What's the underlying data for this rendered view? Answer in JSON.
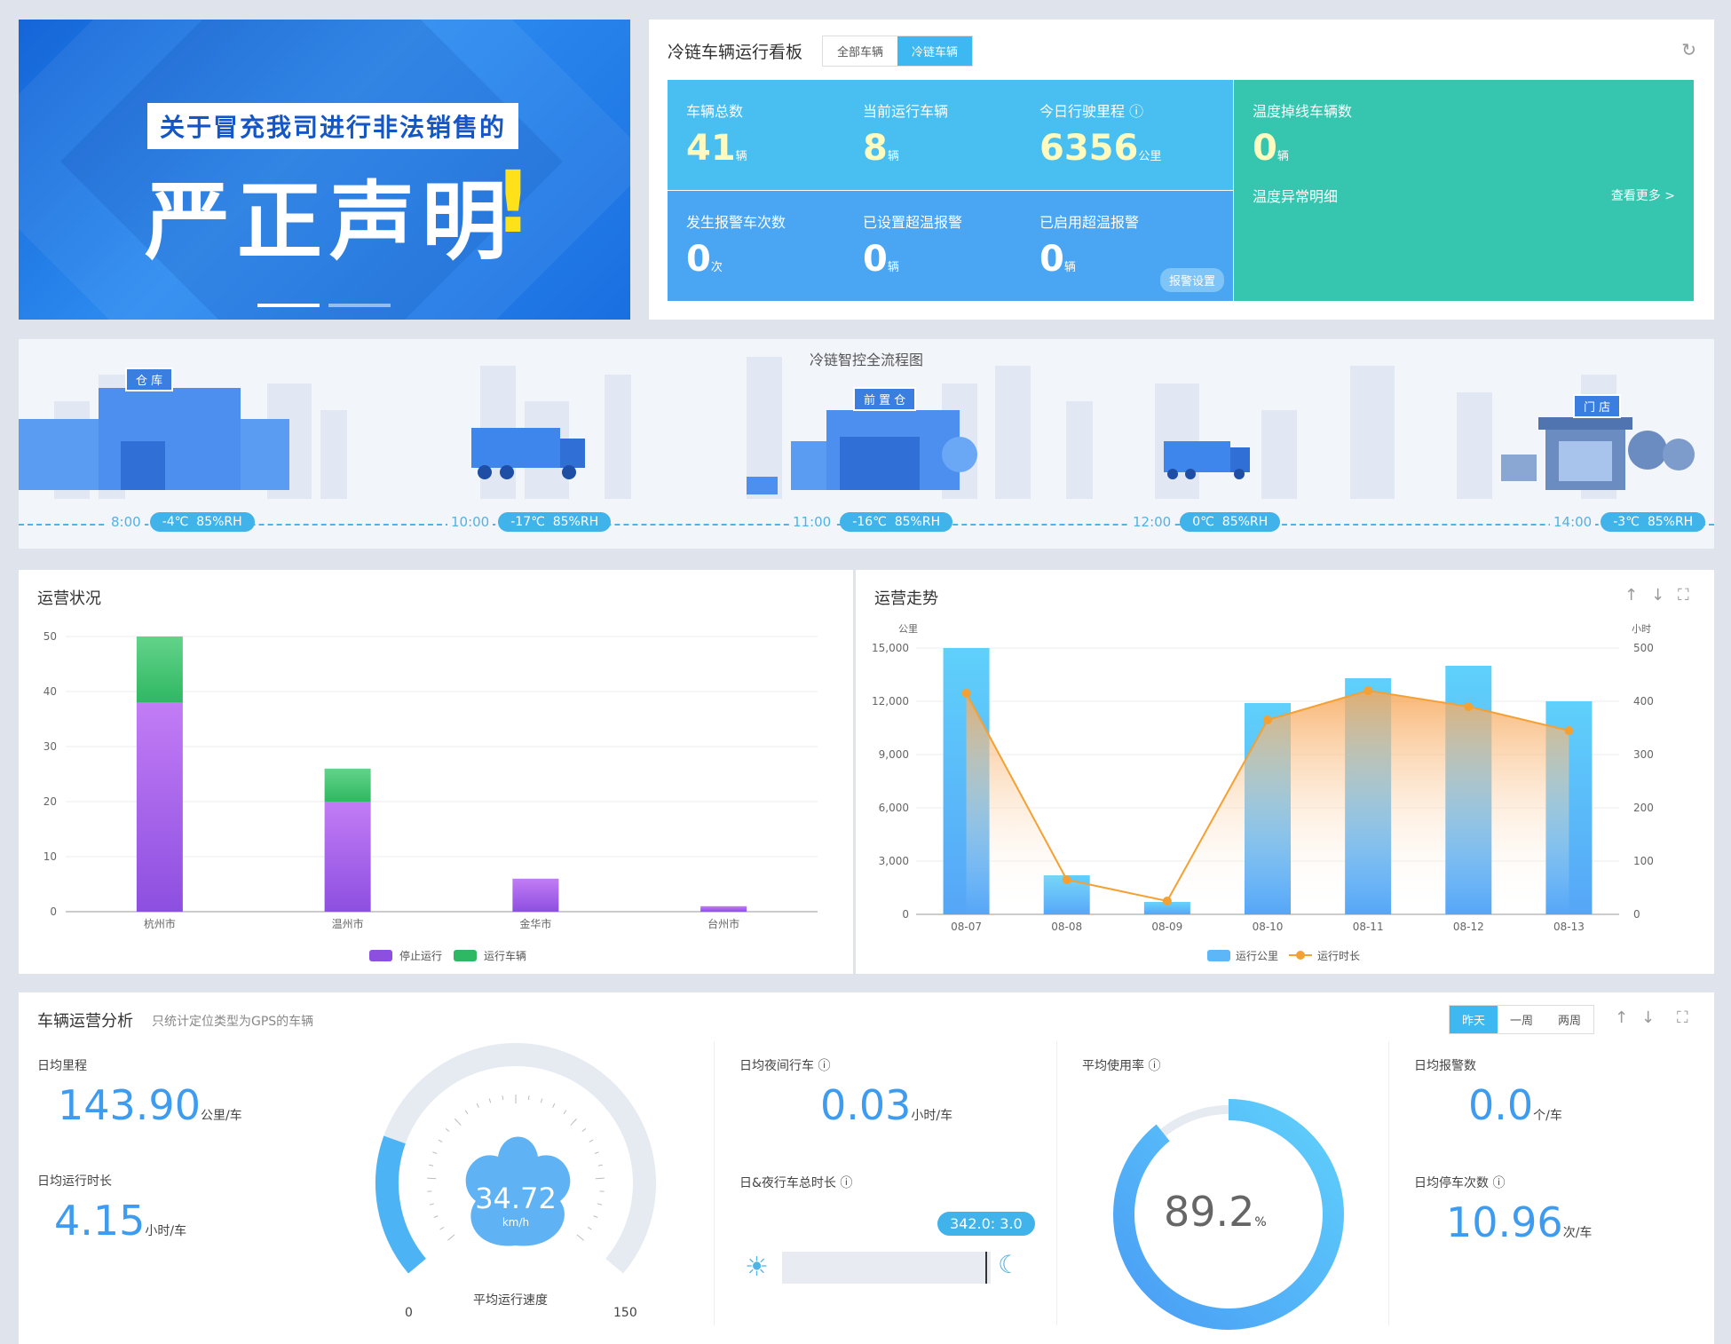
{
  "banner": {
    "subtitle": "关于冒充我司进行非法销售的",
    "headline": "严正声明",
    "exclaim": "!"
  },
  "board": {
    "title": "冷链车辆运行看板",
    "tabs": [
      "全部车辆",
      "冷链车辆"
    ],
    "active_tab": 1,
    "stats_top": [
      {
        "label": "车辆总数",
        "value": "41",
        "unit": "辆"
      },
      {
        "label": "当前运行车辆",
        "value": "8",
        "unit": "辆"
      },
      {
        "label": "今日行驶里程 ⓘ",
        "value": "6356",
        "unit": "公里"
      }
    ],
    "stats_bottom": [
      {
        "label": "发生报警车次数",
        "value": "0",
        "unit": "次"
      },
      {
        "label": "已设置超温报警",
        "value": "0",
        "unit": "辆"
      },
      {
        "label": "已启用超温报警",
        "value": "0",
        "unit": "辆"
      }
    ],
    "alarm_settings": "报警设置",
    "temp_offline": {
      "label": "温度掉线车辆数",
      "value": "0",
      "unit": "辆"
    },
    "temp_detail": "温度异常明细",
    "see_more": "查看更多 >"
  },
  "flow": {
    "title": "冷链智控全流程图",
    "signs": {
      "warehouse": "仓 库",
      "front": "前 置 仓",
      "store": "门 店"
    },
    "points": [
      {
        "time": "8:00",
        "temp": "-4℃",
        "rh": "85%RH"
      },
      {
        "time": "10:00",
        "temp": "-17℃",
        "rh": "85%RH"
      },
      {
        "time": "11:00",
        "temp": "-16℃",
        "rh": "85%RH"
      },
      {
        "time": "12:00",
        "temp": "0℃",
        "rh": "85%RH"
      },
      {
        "time": "14:00",
        "temp": "-3℃",
        "rh": "85%RH"
      }
    ]
  },
  "ops": {
    "title": "运营状况",
    "chart_data": {
      "type": "bar",
      "categories": [
        "杭州市",
        "温州市",
        "金华市",
        "台州市"
      ],
      "series": [
        {
          "name": "停止运行",
          "values": [
            38,
            20,
            6,
            1
          ]
        },
        {
          "name": "运行车辆",
          "values": [
            12,
            6,
            0,
            0
          ]
        }
      ],
      "ylim": [
        0,
        50
      ],
      "yticks": [
        "0",
        "10",
        "20",
        "30",
        "40",
        "50"
      ],
      "stacked": true,
      "legend": "bottom-center",
      "colors": [
        "#8d4fe0",
        "#2fb863"
      ]
    }
  },
  "trend": {
    "title": "运营走势",
    "controls": [
      "↑",
      "↓",
      "⛶"
    ],
    "chart_data": {
      "type": "bar",
      "categories": [
        "08-07",
        "08-08",
        "08-09",
        "08-10",
        "08-11",
        "08-12",
        "08-13"
      ],
      "series": [
        {
          "name": "运行公里",
          "type": "bar",
          "axis": "left",
          "values": [
            15000,
            2200,
            700,
            11900,
            13300,
            14000,
            12000
          ]
        },
        {
          "name": "运行时长",
          "type": "line",
          "axis": "right",
          "values": [
            415,
            65,
            25,
            365,
            420,
            390,
            345
          ]
        }
      ],
      "ylabel_left": "公里",
      "ylabel_right": "小时",
      "ylim_left": [
        0,
        15000
      ],
      "ylim_right": [
        0,
        500
      ],
      "yticks_left": [
        "0",
        "3,000",
        "6,000",
        "9,000",
        "12,000",
        "15,000"
      ],
      "yticks_right": [
        "0",
        "100",
        "200",
        "300",
        "400",
        "500"
      ],
      "legend": "bottom-center",
      "colors": [
        "#5cb6f7",
        "#f5a032"
      ]
    }
  },
  "analysis": {
    "title": "车辆运营分析",
    "note": "只统计定位类型为GPS的车辆",
    "range_tabs": [
      "昨天",
      "一周",
      "两周"
    ],
    "active_range": 0,
    "controls": [
      "↑",
      "↓",
      "⛶"
    ],
    "daily_mileage": {
      "label": "日均里程",
      "value": "143.90",
      "unit": "公里/车"
    },
    "daily_runtime": {
      "label": "日均运行时长",
      "value": "4.15",
      "unit": "小时/车"
    },
    "speed_gauge": {
      "value": "34.72",
      "unit": "km/h",
      "min": "0",
      "max": "150",
      "label": "平均运行速度",
      "fraction": 0.23
    },
    "night_driving": {
      "label": "日均夜间行车 ⓘ",
      "value": "0.03",
      "unit": "小时/车"
    },
    "day_night": {
      "label": "日&夜行车总时长 ⓘ",
      "tooltip": "342.0: 3.0"
    },
    "usage": {
      "label": "平均使用率 ⓘ",
      "value": "89.2",
      "unit": "%",
      "fraction": 0.892
    },
    "daily_alarms": {
      "label": "日均报警数",
      "value": "0.0",
      "unit": "个/车"
    },
    "daily_stops": {
      "label": "日均停车次数 ⓘ",
      "value": "10.96",
      "unit": "次/车"
    }
  }
}
